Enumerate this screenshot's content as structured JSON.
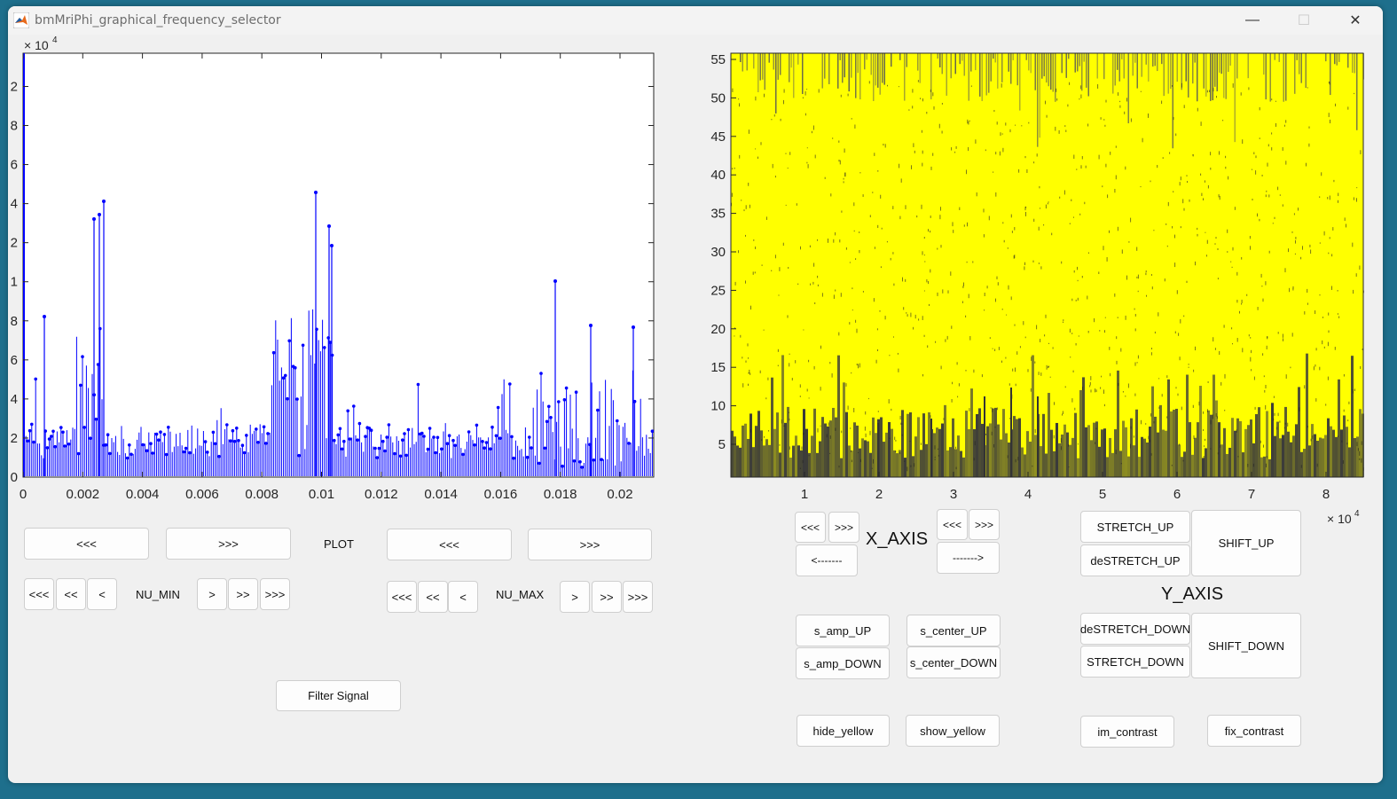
{
  "window": {
    "title": "bmMriPhi_graphical_frequency_selector",
    "controls": {
      "minimize": "—",
      "maximize": "☐",
      "close": "✕"
    },
    "icon": "matlab-logo-icon"
  },
  "colors": {
    "signal": "#0000ff",
    "highlight": "#ffff00",
    "background_image": "#3a3a3a"
  },
  "left_plot": {
    "exponent_base": "× 10",
    "exponent_power": "4",
    "x_ticks": [
      "0",
      "0.002",
      "0.004",
      "0.006",
      "0.008",
      "0.01",
      "0.012",
      "0.014",
      "0.016",
      "0.018",
      "0.02"
    ],
    "y_ticks": [
      "0",
      "2",
      "4",
      "6",
      "8",
      "1",
      "2",
      "4",
      "6",
      "8",
      "2"
    ]
  },
  "right_plot": {
    "exponent_base": "× 10",
    "exponent_power": "4",
    "x_ticks": [
      "1",
      "2",
      "3",
      "4",
      "5",
      "6",
      "7",
      "8"
    ],
    "y_ticks": [
      "5",
      "10",
      "15",
      "20",
      "25",
      "30",
      "35",
      "40",
      "45",
      "50",
      "55"
    ]
  },
  "left_controls": {
    "plot_label": "PLOT",
    "min_left": "<<<",
    "min_right": ">>>",
    "max_left": "<<<",
    "max_right": ">>>",
    "nu_min_label": "NU_MIN",
    "nu_max_label": "NU_MAX",
    "step3_left": "<<<",
    "step2_left": "<<",
    "step1_left": "<",
    "step1_right": ">",
    "step2_right": ">>",
    "step3_right": ">>>",
    "filter_signal": "Filter Signal"
  },
  "right_controls": {
    "x_axis_label": "X_AXIS",
    "y_axis_label": "Y_AXIS",
    "x_left_fast": "<<<",
    "x_left_faster": ">>>",
    "x_left_arrow": "<-------",
    "x_right_fast": "<<<",
    "x_right_faster": ">>>",
    "x_right_arrow": "------->",
    "stretch_up": "STRETCH_UP",
    "destretch_up": "deSTRETCH_UP",
    "shift_up": "SHIFT_UP",
    "destretch_down": "deSTRETCH_DOWN",
    "stretch_down": "STRETCH_DOWN",
    "shift_down": "SHIFT_DOWN",
    "s_amp_up": "s_amp_UP",
    "s_amp_down": "s_amp_DOWN",
    "s_center_up": "s_center_UP",
    "s_center_down": "s_center_DOWN",
    "hide_yellow": "hide_yellow",
    "show_yellow": "show_yellow",
    "im_contrast": "im_contrast",
    "fix_contrast": "fix_contrast"
  }
}
